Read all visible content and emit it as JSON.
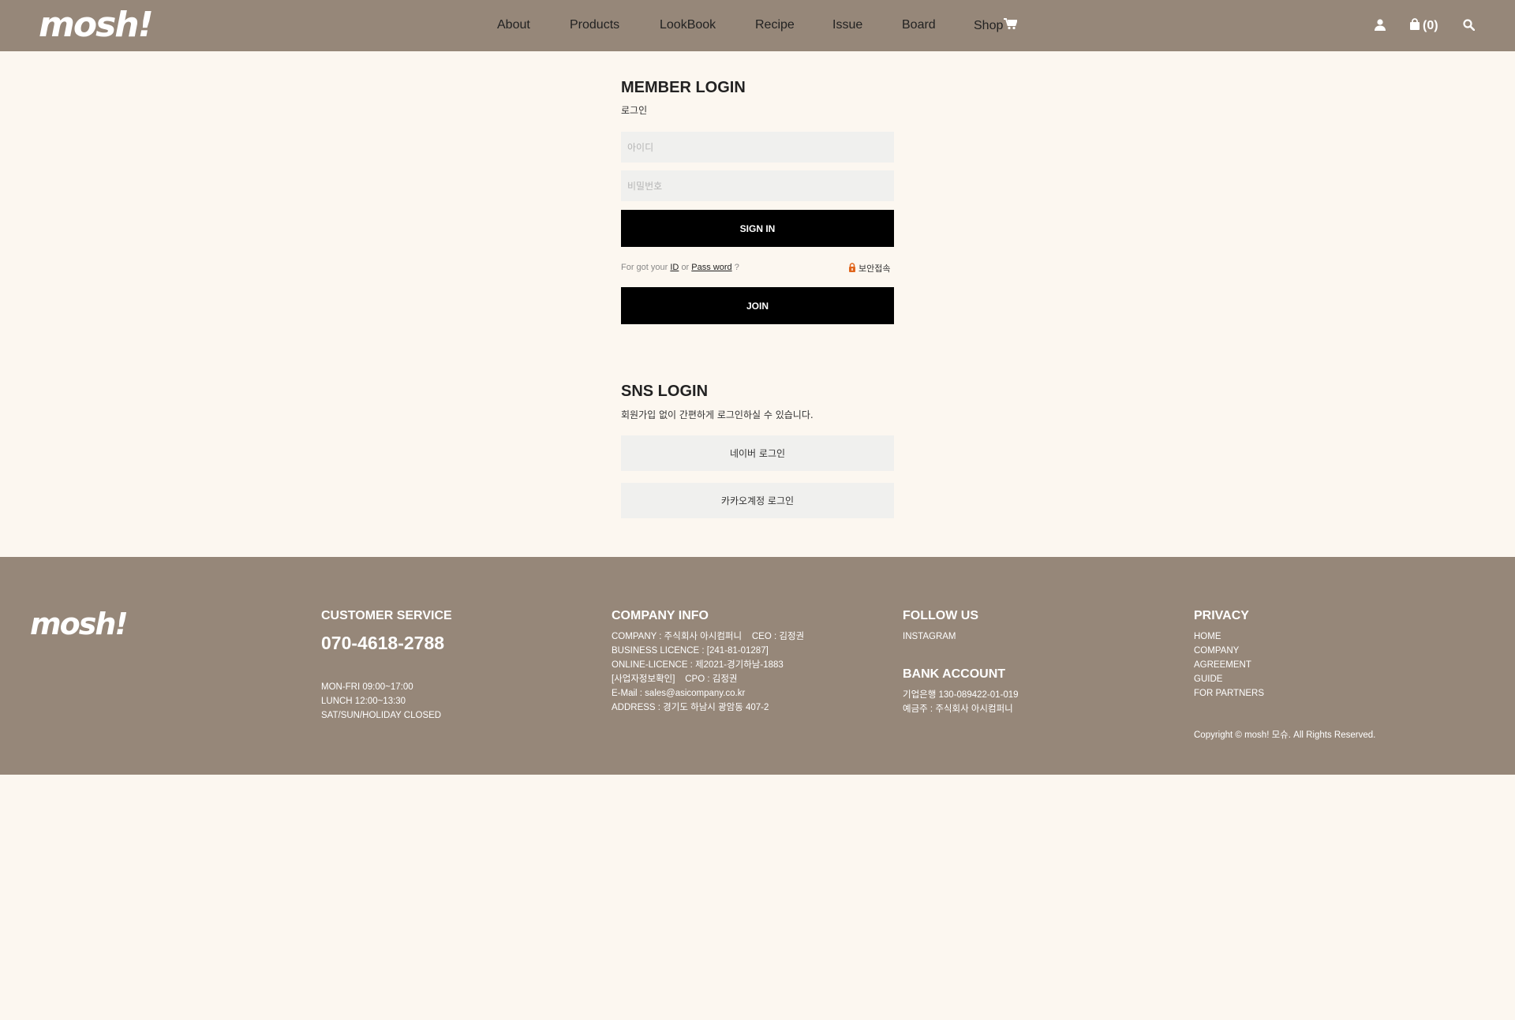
{
  "header": {
    "logo": "mosh!",
    "nav": [
      "About",
      "Products",
      "LookBook",
      "Recipe",
      "Issue",
      "Board",
      "Shop"
    ],
    "cart_count": "(0)",
    "icons": [
      "user-icon",
      "shopping-bag-icon",
      "search-icon",
      "cart-icon"
    ]
  },
  "login": {
    "title": "MEMBER LOGIN",
    "subtitle": "로그인",
    "id_placeholder": "아이디",
    "pw_placeholder": "비밀번호",
    "signin_label": "SIGN IN",
    "forgot_prefix": "For got your",
    "forgot_id": "ID",
    "forgot_or": "or",
    "forgot_pw": "Pass word",
    "forgot_suffix": "?",
    "secure_label": "보안접속",
    "join_label": "JOIN"
  },
  "sns": {
    "title": "SNS LOGIN",
    "subtitle": "회원가입 없이 간편하게 로그인하실 수 있습니다.",
    "naver_label": "네이버 로그인",
    "kakao_label": "카카오계정 로그인"
  },
  "footer": {
    "logo": "mosh!",
    "customer_service": {
      "title": "CUSTOMER SERVICE",
      "phone": "070-4618-2788",
      "hours": [
        "MON-FRI 09:00~17:00",
        "LUNCH 12:00~13:30",
        "SAT/SUN/HOLIDAY CLOSED"
      ]
    },
    "company_info": {
      "title": "COMPANY INFO",
      "lines": [
        "COMPANY : 주식회사 아시컴퍼니    CEO : 김정권",
        "BUSINESS LICENCE : [241-81-01287]",
        "ONLINE-LICENCE : 제2021-경기하남-1883",
        "[사업자정보확인]    CPO : 김정권",
        "E-Mail : sales@asicompany.co.kr",
        "ADDRESS : 경기도 하남시 광암동 407-2"
      ]
    },
    "follow_us": {
      "title": "FOLLOW US",
      "links": [
        "INSTAGRAM"
      ]
    },
    "bank_account": {
      "title": "BANK ACCOUNT",
      "lines": [
        "기업은행 130-089422-01-019",
        "예금주 : 주식회사 아시컴퍼니"
      ]
    },
    "privacy": {
      "title": "PRIVACY",
      "links": [
        "HOME",
        "COMPANY",
        "AGREEMENT",
        "GUIDE",
        "FOR PARTNERS"
      ],
      "copyright": "Copyright © mosh! 모슈. All Rights Reserved."
    }
  }
}
